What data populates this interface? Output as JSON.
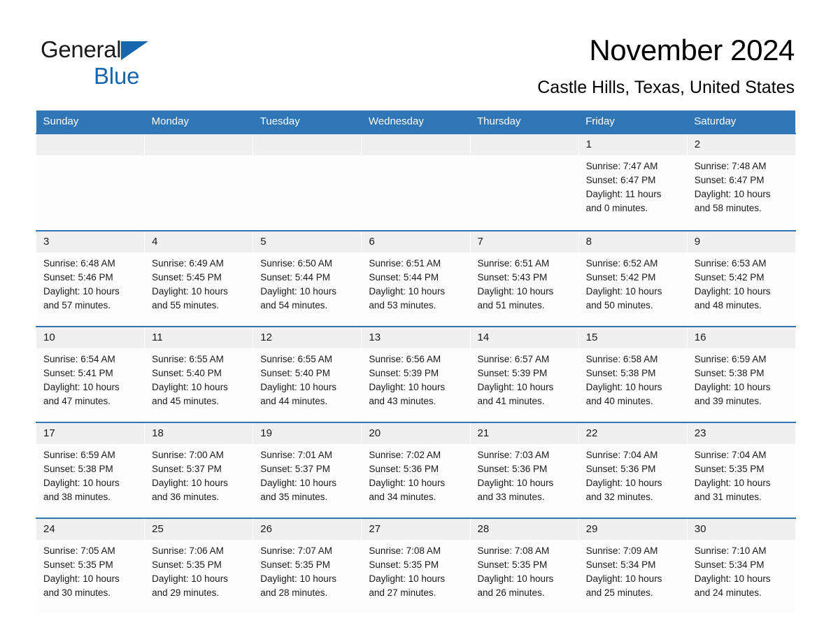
{
  "brand": {
    "name_part1": "General",
    "name_part2": "Blue",
    "logo_icon": "triangle-logo-icon",
    "accent_color": "#1566ad"
  },
  "header": {
    "month_title": "November 2024",
    "location": "Castle Hills, Texas, United States"
  },
  "theme": {
    "header_row_color": "#2f76b6",
    "day_number_strip_color": "#f0f0f0",
    "cell_background": "#fdfdfd",
    "text_color": "#1a1a1a"
  },
  "weekday_headers": [
    "Sunday",
    "Monday",
    "Tuesday",
    "Wednesday",
    "Thursday",
    "Friday",
    "Saturday"
  ],
  "weeks": [
    [
      {
        "day": "",
        "sunrise": "",
        "sunset": "",
        "daylight_line1": "",
        "daylight_line2": "",
        "empty": true
      },
      {
        "day": "",
        "sunrise": "",
        "sunset": "",
        "daylight_line1": "",
        "daylight_line2": "",
        "empty": true
      },
      {
        "day": "",
        "sunrise": "",
        "sunset": "",
        "daylight_line1": "",
        "daylight_line2": "",
        "empty": true
      },
      {
        "day": "",
        "sunrise": "",
        "sunset": "",
        "daylight_line1": "",
        "daylight_line2": "",
        "empty": true
      },
      {
        "day": "",
        "sunrise": "",
        "sunset": "",
        "daylight_line1": "",
        "daylight_line2": "",
        "empty": true
      },
      {
        "day": "1",
        "sunrise": "Sunrise: 7:47 AM",
        "sunset": "Sunset: 6:47 PM",
        "daylight_line1": "Daylight: 11 hours",
        "daylight_line2": "and 0 minutes.",
        "empty": false
      },
      {
        "day": "2",
        "sunrise": "Sunrise: 7:48 AM",
        "sunset": "Sunset: 6:47 PM",
        "daylight_line1": "Daylight: 10 hours",
        "daylight_line2": "and 58 minutes.",
        "empty": false
      }
    ],
    [
      {
        "day": "3",
        "sunrise": "Sunrise: 6:48 AM",
        "sunset": "Sunset: 5:46 PM",
        "daylight_line1": "Daylight: 10 hours",
        "daylight_line2": "and 57 minutes.",
        "empty": false
      },
      {
        "day": "4",
        "sunrise": "Sunrise: 6:49 AM",
        "sunset": "Sunset: 5:45 PM",
        "daylight_line1": "Daylight: 10 hours",
        "daylight_line2": "and 55 minutes.",
        "empty": false
      },
      {
        "day": "5",
        "sunrise": "Sunrise: 6:50 AM",
        "sunset": "Sunset: 5:44 PM",
        "daylight_line1": "Daylight: 10 hours",
        "daylight_line2": "and 54 minutes.",
        "empty": false
      },
      {
        "day": "6",
        "sunrise": "Sunrise: 6:51 AM",
        "sunset": "Sunset: 5:44 PM",
        "daylight_line1": "Daylight: 10 hours",
        "daylight_line2": "and 53 minutes.",
        "empty": false
      },
      {
        "day": "7",
        "sunrise": "Sunrise: 6:51 AM",
        "sunset": "Sunset: 5:43 PM",
        "daylight_line1": "Daylight: 10 hours",
        "daylight_line2": "and 51 minutes.",
        "empty": false
      },
      {
        "day": "8",
        "sunrise": "Sunrise: 6:52 AM",
        "sunset": "Sunset: 5:42 PM",
        "daylight_line1": "Daylight: 10 hours",
        "daylight_line2": "and 50 minutes.",
        "empty": false
      },
      {
        "day": "9",
        "sunrise": "Sunrise: 6:53 AM",
        "sunset": "Sunset: 5:42 PM",
        "daylight_line1": "Daylight: 10 hours",
        "daylight_line2": "and 48 minutes.",
        "empty": false
      }
    ],
    [
      {
        "day": "10",
        "sunrise": "Sunrise: 6:54 AM",
        "sunset": "Sunset: 5:41 PM",
        "daylight_line1": "Daylight: 10 hours",
        "daylight_line2": "and 47 minutes.",
        "empty": false
      },
      {
        "day": "11",
        "sunrise": "Sunrise: 6:55 AM",
        "sunset": "Sunset: 5:40 PM",
        "daylight_line1": "Daylight: 10 hours",
        "daylight_line2": "and 45 minutes.",
        "empty": false
      },
      {
        "day": "12",
        "sunrise": "Sunrise: 6:55 AM",
        "sunset": "Sunset: 5:40 PM",
        "daylight_line1": "Daylight: 10 hours",
        "daylight_line2": "and 44 minutes.",
        "empty": false
      },
      {
        "day": "13",
        "sunrise": "Sunrise: 6:56 AM",
        "sunset": "Sunset: 5:39 PM",
        "daylight_line1": "Daylight: 10 hours",
        "daylight_line2": "and 43 minutes.",
        "empty": false
      },
      {
        "day": "14",
        "sunrise": "Sunrise: 6:57 AM",
        "sunset": "Sunset: 5:39 PM",
        "daylight_line1": "Daylight: 10 hours",
        "daylight_line2": "and 41 minutes.",
        "empty": false
      },
      {
        "day": "15",
        "sunrise": "Sunrise: 6:58 AM",
        "sunset": "Sunset: 5:38 PM",
        "daylight_line1": "Daylight: 10 hours",
        "daylight_line2": "and 40 minutes.",
        "empty": false
      },
      {
        "day": "16",
        "sunrise": "Sunrise: 6:59 AM",
        "sunset": "Sunset: 5:38 PM",
        "daylight_line1": "Daylight: 10 hours",
        "daylight_line2": "and 39 minutes.",
        "empty": false
      }
    ],
    [
      {
        "day": "17",
        "sunrise": "Sunrise: 6:59 AM",
        "sunset": "Sunset: 5:38 PM",
        "daylight_line1": "Daylight: 10 hours",
        "daylight_line2": "and 38 minutes.",
        "empty": false
      },
      {
        "day": "18",
        "sunrise": "Sunrise: 7:00 AM",
        "sunset": "Sunset: 5:37 PM",
        "daylight_line1": "Daylight: 10 hours",
        "daylight_line2": "and 36 minutes.",
        "empty": false
      },
      {
        "day": "19",
        "sunrise": "Sunrise: 7:01 AM",
        "sunset": "Sunset: 5:37 PM",
        "daylight_line1": "Daylight: 10 hours",
        "daylight_line2": "and 35 minutes.",
        "empty": false
      },
      {
        "day": "20",
        "sunrise": "Sunrise: 7:02 AM",
        "sunset": "Sunset: 5:36 PM",
        "daylight_line1": "Daylight: 10 hours",
        "daylight_line2": "and 34 minutes.",
        "empty": false
      },
      {
        "day": "21",
        "sunrise": "Sunrise: 7:03 AM",
        "sunset": "Sunset: 5:36 PM",
        "daylight_line1": "Daylight: 10 hours",
        "daylight_line2": "and 33 minutes.",
        "empty": false
      },
      {
        "day": "22",
        "sunrise": "Sunrise: 7:04 AM",
        "sunset": "Sunset: 5:36 PM",
        "daylight_line1": "Daylight: 10 hours",
        "daylight_line2": "and 32 minutes.",
        "empty": false
      },
      {
        "day": "23",
        "sunrise": "Sunrise: 7:04 AM",
        "sunset": "Sunset: 5:35 PM",
        "daylight_line1": "Daylight: 10 hours",
        "daylight_line2": "and 31 minutes.",
        "empty": false
      }
    ],
    [
      {
        "day": "24",
        "sunrise": "Sunrise: 7:05 AM",
        "sunset": "Sunset: 5:35 PM",
        "daylight_line1": "Daylight: 10 hours",
        "daylight_line2": "and 30 minutes.",
        "empty": false
      },
      {
        "day": "25",
        "sunrise": "Sunrise: 7:06 AM",
        "sunset": "Sunset: 5:35 PM",
        "daylight_line1": "Daylight: 10 hours",
        "daylight_line2": "and 29 minutes.",
        "empty": false
      },
      {
        "day": "26",
        "sunrise": "Sunrise: 7:07 AM",
        "sunset": "Sunset: 5:35 PM",
        "daylight_line1": "Daylight: 10 hours",
        "daylight_line2": "and 28 minutes.",
        "empty": false
      },
      {
        "day": "27",
        "sunrise": "Sunrise: 7:08 AM",
        "sunset": "Sunset: 5:35 PM",
        "daylight_line1": "Daylight: 10 hours",
        "daylight_line2": "and 27 minutes.",
        "empty": false
      },
      {
        "day": "28",
        "sunrise": "Sunrise: 7:08 AM",
        "sunset": "Sunset: 5:35 PM",
        "daylight_line1": "Daylight: 10 hours",
        "daylight_line2": "and 26 minutes.",
        "empty": false
      },
      {
        "day": "29",
        "sunrise": "Sunrise: 7:09 AM",
        "sunset": "Sunset: 5:34 PM",
        "daylight_line1": "Daylight: 10 hours",
        "daylight_line2": "and 25 minutes.",
        "empty": false
      },
      {
        "day": "30",
        "sunrise": "Sunrise: 7:10 AM",
        "sunset": "Sunset: 5:34 PM",
        "daylight_line1": "Daylight: 10 hours",
        "daylight_line2": "and 24 minutes.",
        "empty": false
      }
    ]
  ]
}
